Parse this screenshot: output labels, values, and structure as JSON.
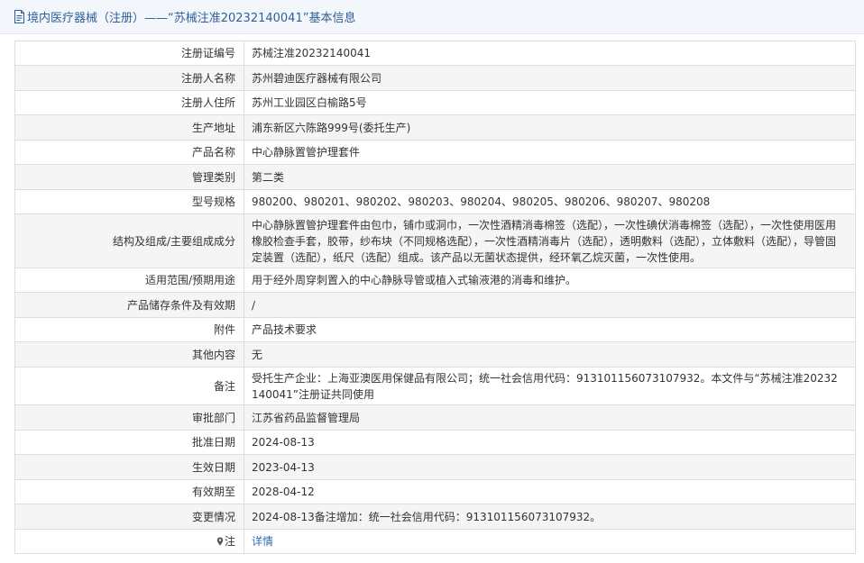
{
  "header": {
    "title": "境内医疗器械（注册）——“苏械注准20232140041”基本信息",
    "icon": "document-icon"
  },
  "rows": [
    {
      "label": "注册证编号",
      "value": "苏械注准20232140041"
    },
    {
      "label": "注册人名称",
      "value": "苏州碧迪医疗器械有限公司"
    },
    {
      "label": "注册人住所",
      "value": "苏州工业园区白榆路5号"
    },
    {
      "label": "生产地址",
      "value": "浦东新区六陈路999号(委托生产)"
    },
    {
      "label": "产品名称",
      "value": "中心静脉置管护理套件"
    },
    {
      "label": "管理类别",
      "value": "第二类"
    },
    {
      "label": "型号规格",
      "value": "980200、980201、980202、980203、980204、980205、980206、980207、980208"
    },
    {
      "label": "结构及组成/主要组成成分",
      "value": "中心静脉置管护理套件由包巾，铺巾或洞巾，一次性酒精消毒棉签（选配），一次性碘伏消毒棉签（选配），一次性使用医用橡胶检查手套，胶带，纱布块（不同规格选配），一次性酒精消毒片（选配），透明敷料（选配），立体敷料（选配），导管固定装置（选配），纸尺（选配）组成。该产品以无菌状态提供，经环氧乙烷灭菌，一次性使用。"
    },
    {
      "label": "适用范围/预期用途",
      "value": "用于经外周穿刺置入的中心静脉导管或植入式输液港的消毒和维护。"
    },
    {
      "label": "产品储存条件及有效期",
      "value": "/"
    },
    {
      "label": "附件",
      "value": "产品技术要求"
    },
    {
      "label": "其他内容",
      "value": "无"
    },
    {
      "label": "备注",
      "value": "受托生产企业：上海亚澳医用保健品有限公司；统一社会信用代码：913101156073107932。本文件与“苏械注准20232140041”注册证共同使用"
    },
    {
      "label": "审批部门",
      "value": "江苏省药品监督管理局"
    },
    {
      "label": "批准日期",
      "value": "2024-08-13"
    },
    {
      "label": "生效日期",
      "value": "2023-04-13"
    },
    {
      "label": "有效期至",
      "value": "2028-04-12"
    },
    {
      "label": "变更情况",
      "value": "2024-08-13备注增加：统一社会信用代码：913101156073107932。"
    }
  ],
  "note_row": {
    "label": "注",
    "icon": "map-pin-icon",
    "link_text": "详情",
    "link_color": "#2f6db5"
  },
  "colors": {
    "header_bg": "#f3f6fa",
    "header_text": "#2f5f9a",
    "row_alt_bg": "#f5f5f5",
    "border": "#dddddd"
  }
}
